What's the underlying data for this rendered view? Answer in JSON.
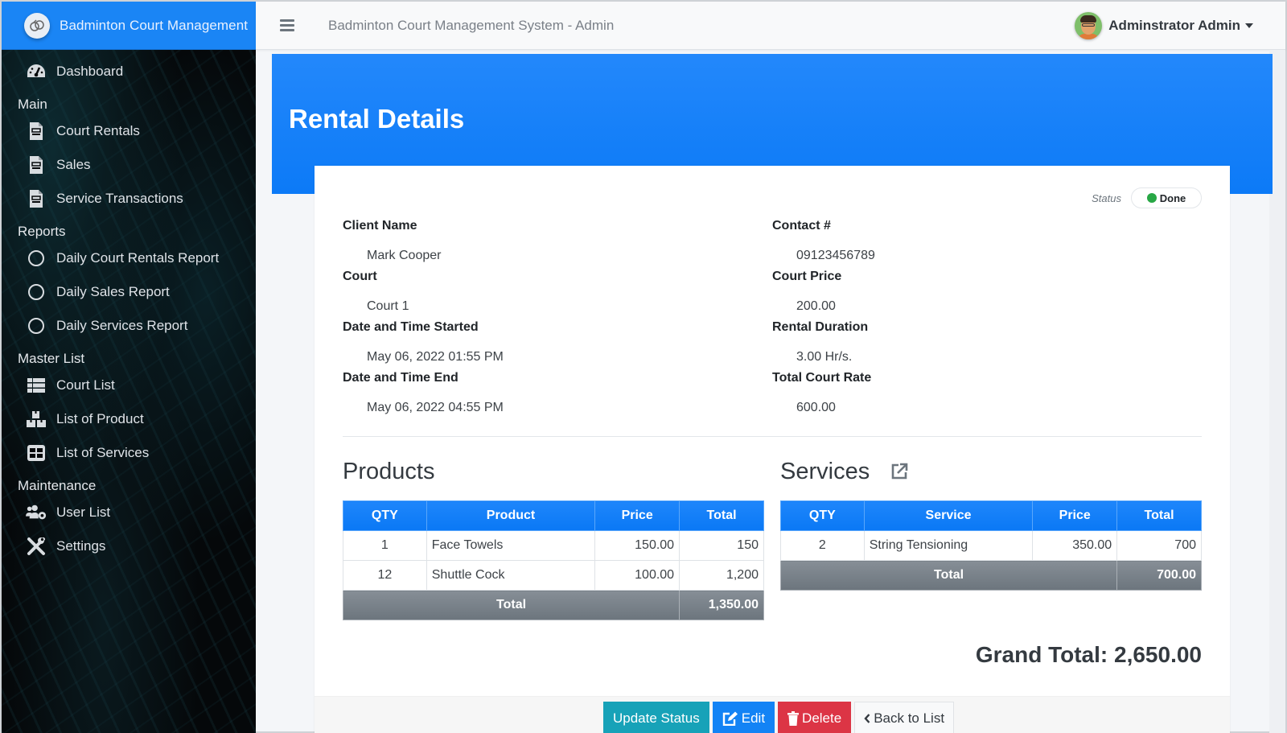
{
  "brand": {
    "name": "Badminton Court Management"
  },
  "topbar": {
    "title": "Badminton Court Management System - Admin",
    "user_name": "Adminstrator Admin"
  },
  "sidebar": {
    "dashboard": "Dashboard",
    "sections": [
      {
        "header": "Main",
        "items": [
          "Court Rentals",
          "Sales",
          "Service Transactions"
        ]
      },
      {
        "header": "Reports",
        "items": [
          "Daily Court Rentals Report",
          "Daily Sales Report",
          "Daily Services Report"
        ]
      },
      {
        "header": "Master List",
        "items": [
          "Court List",
          "List of Product",
          "List of Services"
        ]
      },
      {
        "header": "Maintenance",
        "items": [
          "User List",
          "Settings"
        ]
      }
    ]
  },
  "page": {
    "title": "Rental Details"
  },
  "status": {
    "label": "Status",
    "value": "Done",
    "color": "#28a745"
  },
  "details": {
    "left": [
      {
        "label": "Client Name",
        "value": "Mark Cooper"
      },
      {
        "label": "Court",
        "value": "Court 1"
      },
      {
        "label": "Date and Time Started",
        "value": "May 06, 2022 01:55 PM"
      },
      {
        "label": "Date and Time End",
        "value": "May 06, 2022 04:55 PM"
      }
    ],
    "right": [
      {
        "label": "Contact #",
        "value": "09123456789"
      },
      {
        "label": "Court Price",
        "value": "200.00"
      },
      {
        "label": "Rental Duration",
        "value": "3.00 Hr/s."
      },
      {
        "label": "Total Court Rate",
        "value": "600.00"
      }
    ]
  },
  "products": {
    "title": "Products",
    "columns": [
      "QTY",
      "Product",
      "Price",
      "Total"
    ],
    "rows": [
      {
        "qty": "1",
        "name": "Face Towels",
        "price": "150.00",
        "total": "150"
      },
      {
        "qty": "12",
        "name": "Shuttle Cock",
        "price": "100.00",
        "total": "1,200"
      }
    ],
    "total_label": "Total",
    "total_value": "1,350.00"
  },
  "services": {
    "title": "Services",
    "columns": [
      "QTY",
      "Service",
      "Price",
      "Total"
    ],
    "rows": [
      {
        "qty": "2",
        "name": "String Tensioning",
        "price": "350.00",
        "total": "700"
      }
    ],
    "total_label": "Total",
    "total_value": "700.00"
  },
  "grand_total": "Grand Total: 2,650.00",
  "actions": {
    "update_status": "Update Status",
    "edit": "Edit",
    "delete": "Delete",
    "back": "Back to List"
  },
  "colors": {
    "brand_blue": "#1a85f5",
    "header_blue": "#0c7af7",
    "info": "#17a2b8",
    "danger": "#dc3545",
    "secondary": "#6c757d"
  }
}
